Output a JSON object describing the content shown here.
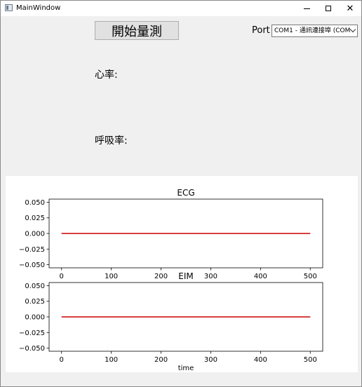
{
  "window": {
    "title": "MainWindow",
    "controls": {
      "minimize": "minimize-icon",
      "maximize": "maximize-icon",
      "close": "close-icon"
    }
  },
  "toolbar": {
    "start_label": "開始量測",
    "port_label": "Port",
    "port_value": "COM1 - 通訊連接埠 (COM1)"
  },
  "readouts": {
    "heart_rate_label": "心率:",
    "breath_rate_label": "呼吸率:"
  },
  "chart_data": [
    {
      "type": "line",
      "title": "ECG",
      "xlabel": "",
      "ylabel": "",
      "xlim": [
        -25,
        525
      ],
      "ylim": [
        -0.055,
        0.055
      ],
      "xticks": [
        0,
        100,
        200,
        300,
        400,
        500
      ],
      "xtick_labels": [
        "0",
        "100",
        "200",
        "300",
        "400",
        "500"
      ],
      "yticks": [
        0.05,
        0.025,
        0.0,
        -0.025,
        -0.05
      ],
      "ytick_labels": [
        "0.050",
        "0.025",
        "0.000",
        "−0.025",
        "−0.050"
      ],
      "series": [
        {
          "x": [
            0,
            500
          ],
          "y": [
            0,
            0
          ],
          "color": "#cc0000"
        }
      ]
    },
    {
      "type": "line",
      "title": "EIM",
      "xlabel": "time",
      "ylabel": "",
      "xlim": [
        -25,
        525
      ],
      "ylim": [
        -0.055,
        0.055
      ],
      "xticks": [
        0,
        100,
        200,
        300,
        400,
        500
      ],
      "xtick_labels": [
        "0",
        "100",
        "200",
        "300",
        "400",
        "500"
      ],
      "yticks": [
        0.05,
        0.025,
        0.0,
        -0.025,
        -0.05
      ],
      "ytick_labels": [
        "0.050",
        "0.025",
        "0.000",
        "−0.025",
        "−0.050"
      ],
      "series": [
        {
          "x": [
            0,
            500
          ],
          "y": [
            0,
            0
          ],
          "color": "#cc0000"
        }
      ]
    }
  ]
}
